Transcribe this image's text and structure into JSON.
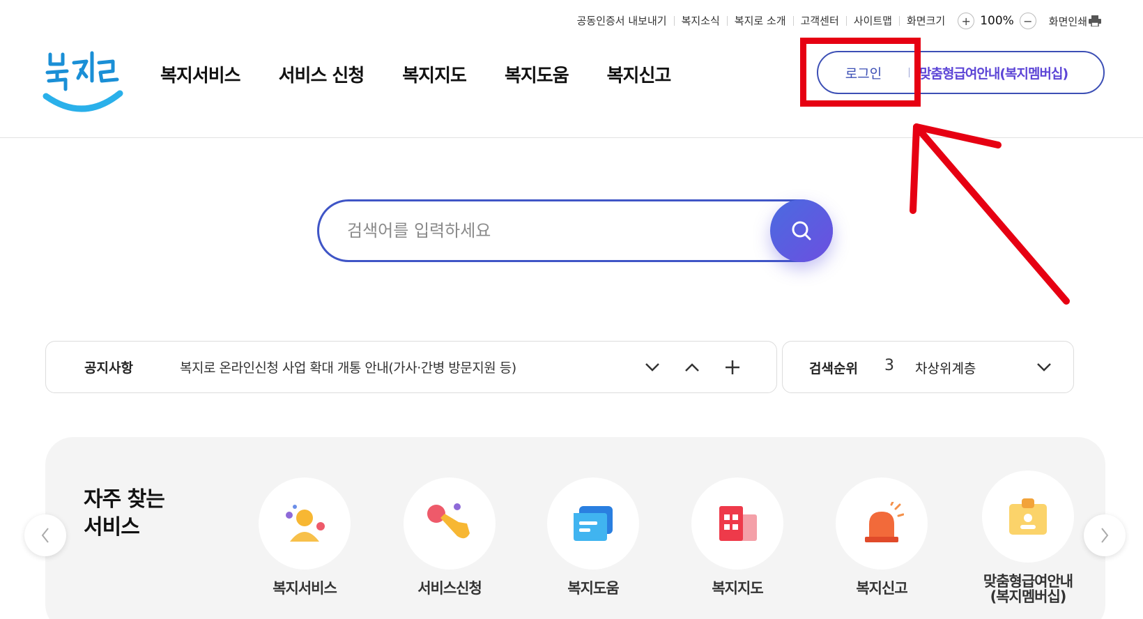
{
  "utility": {
    "links": [
      "공동인증서 내보내기",
      "복지소식",
      "복지로 소개",
      "고객센터",
      "사이트맵",
      "화면크기"
    ],
    "zoom_in": "+",
    "zoom_value": "100%",
    "zoom_out": "−",
    "print": "화면인쇄"
  },
  "logo": {
    "text": "복지로"
  },
  "nav": [
    "복지서비스",
    "서비스 신청",
    "복지지도",
    "복지도움",
    "복지신고"
  ],
  "account": {
    "login": "로그인",
    "membership": "맞춤형급여안내(복지멤버십)"
  },
  "search": {
    "placeholder": "검색어를 입력하세요"
  },
  "notice": {
    "label": "공지사항",
    "text": "복지로 온라인신청 사업 확대 개통 안내(가사·간병 방문지원 등)"
  },
  "ranking": {
    "label": "검색순위",
    "number": "3",
    "term": "차상위계층"
  },
  "favorites": {
    "title_line1": "자주 찾는",
    "title_line2": "서비스",
    "items": [
      {
        "label": "복지서비스",
        "icon": "person-icon"
      },
      {
        "label": "서비스신청",
        "icon": "hand-pointer-icon"
      },
      {
        "label": "복지도움",
        "icon": "chat-icon"
      },
      {
        "label": "복지지도",
        "icon": "building-icon"
      },
      {
        "label": "복지신고",
        "icon": "siren-icon"
      },
      {
        "label_line1": "맞춤형급여안내",
        "label_line2": "(복지멤버십)",
        "icon": "id-card-icon"
      }
    ]
  },
  "colors": {
    "primary": "#3f55c6",
    "purple": "#5c45d6",
    "highlight": "#e60012"
  }
}
